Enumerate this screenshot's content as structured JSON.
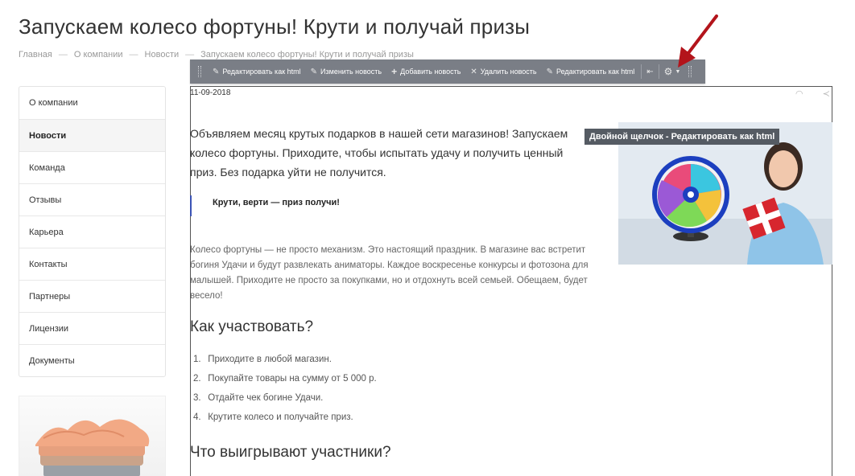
{
  "page": {
    "title": "Запускаем колесо фортуны! Крути и получай призы"
  },
  "breadcrumb": {
    "items": [
      "Главная",
      "О компании",
      "Новости",
      "Запускаем колесо фортуны! Крути и получай призы"
    ],
    "separator": "—"
  },
  "sidebar": {
    "items": [
      {
        "label": "О компании"
      },
      {
        "label": "Новости",
        "active": true
      },
      {
        "label": "Команда"
      },
      {
        "label": "Отзывы"
      },
      {
        "label": "Карьера"
      },
      {
        "label": "Контакты"
      },
      {
        "label": "Партнеры"
      },
      {
        "label": "Лицензии"
      },
      {
        "label": "Документы"
      }
    ]
  },
  "toolbar": {
    "edit_html": "Редактировать как html",
    "edit_news": "Изменить новость",
    "add_news": "Добавить новость",
    "delete_news": "Удалить новость",
    "edit_html_2": "Редактировать как html",
    "icons": [
      "pencil-icon",
      "plus-icon",
      "close-icon",
      "pin-icon",
      "gear-icon",
      "chevron-down-icon"
    ]
  },
  "tooltip": {
    "text": "Двойной щелчок - Редактировать  как html"
  },
  "article": {
    "date": "11-09-2018",
    "lead": "Объявляем месяц крутых подарков в нашей сети магазинов! Запускаем колесо фортуны. Приходите, чтобы испытать удачу и получить ценный приз. Без подарка уйти не получится.",
    "quote": "Крути, верти — приз получи!",
    "body": "Колесо фортуны — не просто механизм. Это настоящий праздник. В магазине вас встретит богиня Удачи и будут развлекать аниматоры. Каждое воскресенье конкурсы и фотозона для малышей. Приходите не просто за покупками, но и отдохнуть всей семьей. Обещаем, будет весело!",
    "heading_how": "Как участвовать?",
    "steps": [
      {
        "n": "1.",
        "text": "Приходите в любой магазин."
      },
      {
        "n": "2.",
        "text": "Покупайте товары на сумму от 5 000 р."
      },
      {
        "n": "3.",
        "text": "Отдайте чек богине Удачи."
      },
      {
        "n": "4.",
        "text": "Крутите колесо и получайте приз."
      }
    ],
    "heading_win": "Что выигрывают участники?"
  },
  "colors": {
    "toolbar_bg": "#7a7e86",
    "tooltip_bg": "#555b63",
    "quote_border": "#3b53b5",
    "arrow": "#b3141b",
    "gift": "#d7262e"
  }
}
